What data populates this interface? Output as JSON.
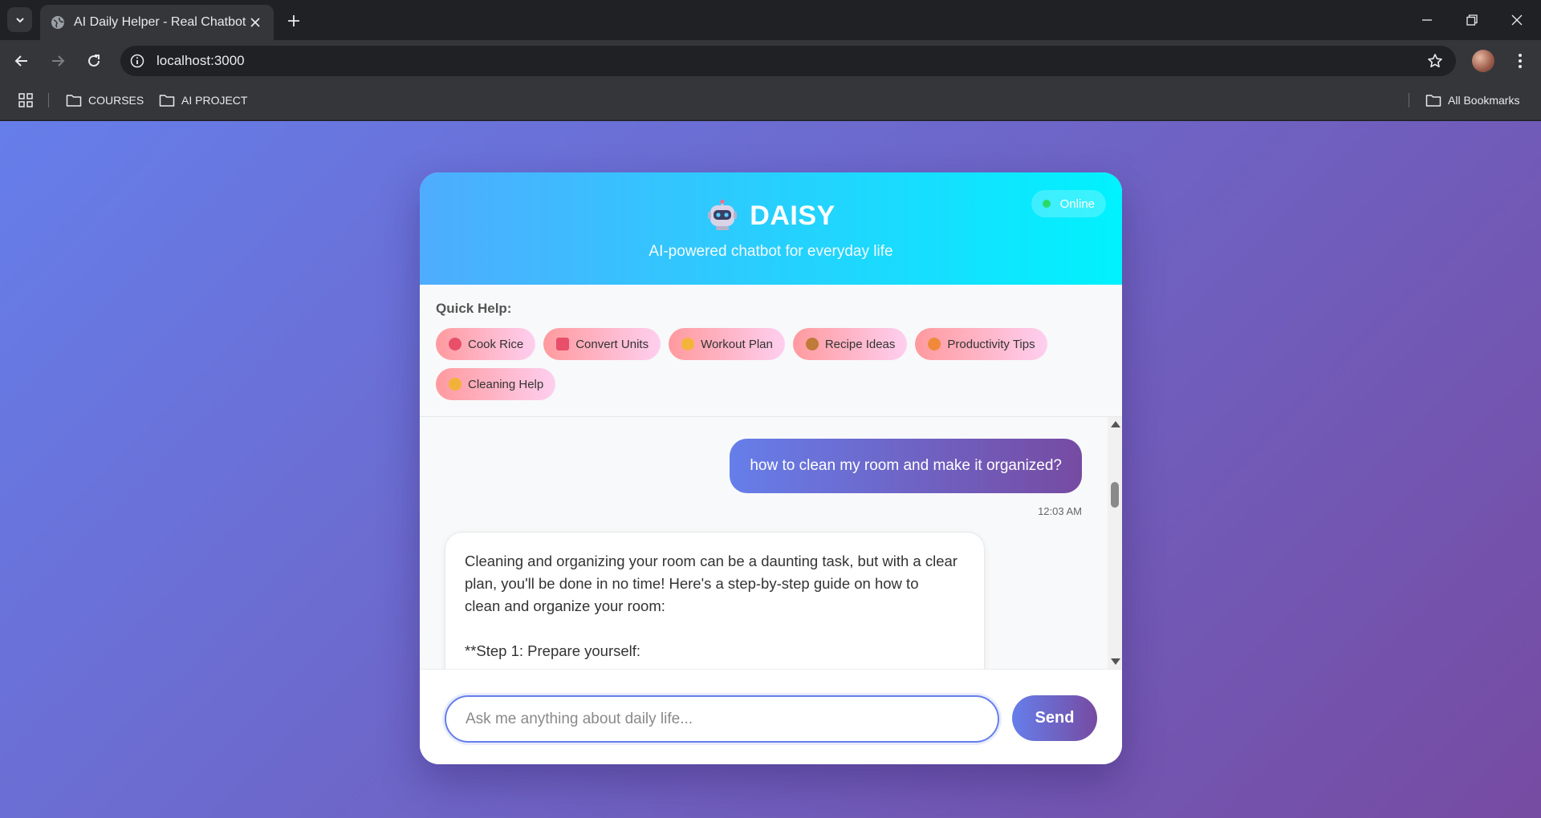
{
  "browser": {
    "tab_title": "AI Daily Helper - Real Chatbot",
    "url": "localhost:3000",
    "bookmarks": [
      "COURSES",
      "AI PROJECT"
    ],
    "all_bookmarks": "All Bookmarks"
  },
  "chat": {
    "title": "DAISY",
    "subtitle": "AI-powered chatbot for everyday life",
    "status": "Online",
    "quick_help_label": "Quick Help:",
    "quick_actions": [
      {
        "label": "Cook Rice",
        "icon": "rice-bowl-icon",
        "color": "#e8506a"
      },
      {
        "label": "Convert Units",
        "icon": "cup-icon",
        "color": "#e84f6a"
      },
      {
        "label": "Workout Plan",
        "icon": "muscle-icon",
        "color": "#f4b43a"
      },
      {
        "label": "Recipe Ideas",
        "icon": "herb-icon",
        "color": "#c07a3a"
      },
      {
        "label": "Productivity Tips",
        "icon": "bulb-icon",
        "color": "#f08a3a"
      },
      {
        "label": "Cleaning Help",
        "icon": "sponge-icon",
        "color": "#f2b23a"
      }
    ],
    "messages": {
      "user_text": "how to clean my room and make it organized?",
      "user_time": "12:03 AM",
      "bot_line1": "Cleaning and organizing your room can be a daunting task, but with a clear",
      "bot_line2": "plan, you'll be done in no time! Here's a step-by-step guide on how to",
      "bot_line3": "clean and organize your room:",
      "bot_line4": "**Step 1: Prepare yourself:"
    },
    "input_placeholder": "Ask me anything about daily life...",
    "send_label": "Send"
  },
  "colors": {
    "page_gradient": [
      "#667eea",
      "#764ba2"
    ],
    "header_gradient": [
      "#4facfe",
      "#00f2fe"
    ],
    "chip_gradient": [
      "#ff9a9e",
      "#fecfef"
    ],
    "status_dot": "#2bd96b"
  }
}
